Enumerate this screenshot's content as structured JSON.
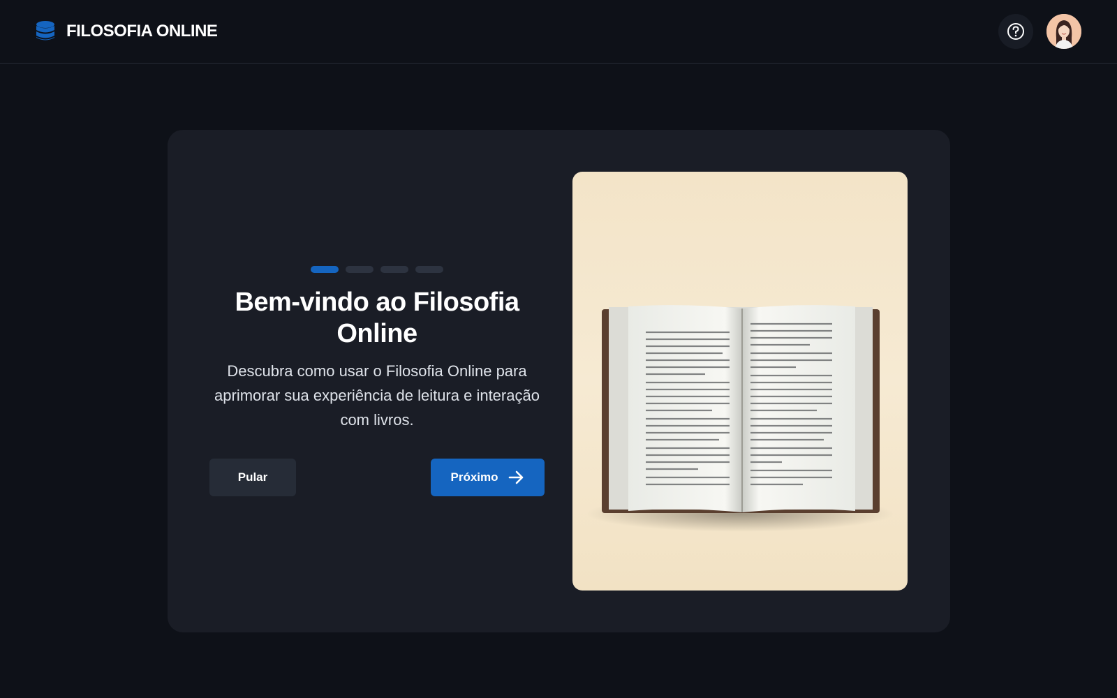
{
  "header": {
    "brand_name": "FILOSOFIA ONLINE",
    "logo_icon": "database-stack-icon",
    "help_icon": "help-circle-icon",
    "avatar": "user-avatar"
  },
  "onboarding": {
    "step_current": 1,
    "step_total": 4,
    "title": "Bem-vindo ao Filosofia Online",
    "description": "Descubra como usar o Filosofia Online para aprimorar sua experiência de leitura e interação com livros.",
    "skip_label": "Pular",
    "next_label": "Próximo",
    "next_icon": "arrow-right-icon",
    "illustration": "open-book-illustration"
  },
  "colors": {
    "background": "#0e1118",
    "card": "#1a1d26",
    "accent": "#1565c0",
    "secondary_button": "#262c37",
    "illustration_bg": "#f3e4c8"
  }
}
